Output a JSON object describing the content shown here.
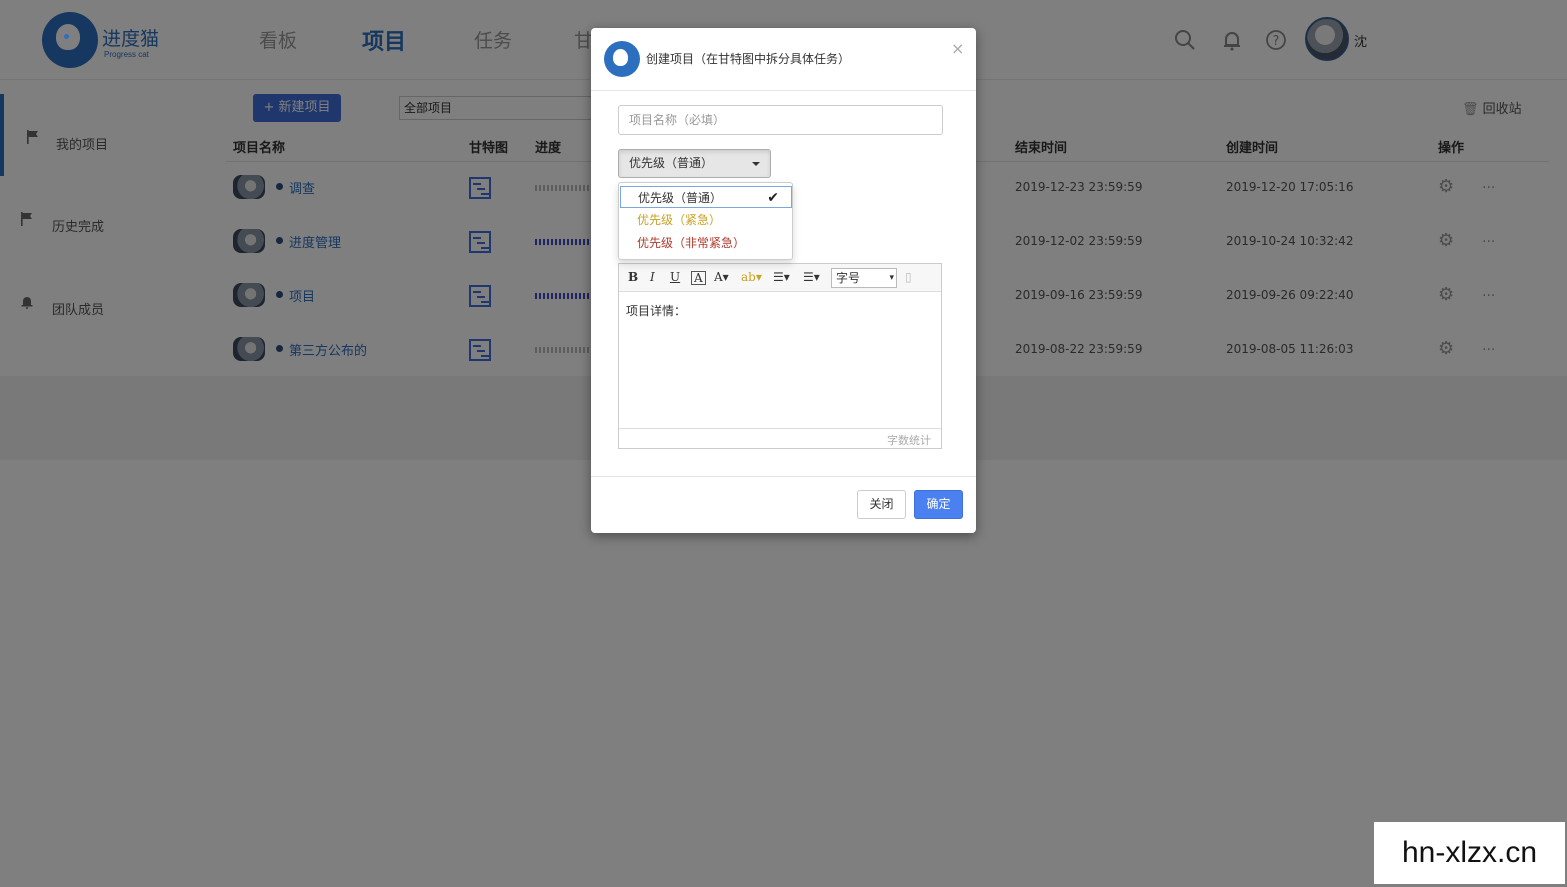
{
  "app": {
    "logo_text": "进度猫",
    "logo_sub": "Progress cat"
  },
  "nav": {
    "items": [
      "看板",
      "项目",
      "任务",
      "甘"
    ],
    "active": "项目"
  },
  "header": {
    "user_name": "沈"
  },
  "sidebar": {
    "items": [
      {
        "label": "我的项目",
        "icon": "flag-icon"
      },
      {
        "label": "历史完成",
        "icon": "flag-icon"
      },
      {
        "label": "团队成员",
        "icon": "bell-icon"
      }
    ]
  },
  "toolbar": {
    "new_project": "+ 新建项目",
    "filter_value": "全部项目",
    "recycle": "回收站"
  },
  "table": {
    "headers": {
      "name": "项目名称",
      "gantt": "甘特图",
      "progress": "进度",
      "end": "结束时间",
      "created": "创建时间",
      "ops": "操作"
    },
    "rows": [
      {
        "name": "调查",
        "end": "2019-12-23 23:59:59",
        "created": "2019-12-20 17:05:16",
        "more": "...",
        "progress": 0.0
      },
      {
        "name": "进度管理",
        "end": "2019-12-02 23:59:59",
        "created": "2019-10-24 10:32:42",
        "more": "...",
        "progress": 0.5
      },
      {
        "name": "项目",
        "end": "2019-09-16 23:59:59",
        "created": "2019-09-26 09:22:40",
        "more": "...",
        "progress": 1.0
      },
      {
        "name": "第三方公布的",
        "end": "2019-08-22 23:59:59",
        "created": "2019-08-05 11:26:03",
        "more": "...",
        "progress": 0.0
      }
    ]
  },
  "modal": {
    "title": "创建项目（在甘特图中拆分具体任务）",
    "close_symbol": "×",
    "name_placeholder": "项目名称（必填）",
    "priority_value": "优先级（普通）",
    "priority_options": [
      {
        "label": "优先级（普通）",
        "color": "#333333"
      },
      {
        "label": "优先级（紧急）",
        "color": "#c9a227"
      },
      {
        "label": "优先级（非常紧急）",
        "color": "#b03a2e"
      }
    ],
    "check_symbol": "✔",
    "editor": {
      "font_size": "字号",
      "content": "项目详情：",
      "word_count": "字数统计"
    },
    "close_button": "关闭",
    "confirm_button": "确定"
  },
  "colors": {
    "brand": "#2d6fbf",
    "primary_button": "#4a80f0"
  },
  "watermark": "hn-xlzx.cn"
}
